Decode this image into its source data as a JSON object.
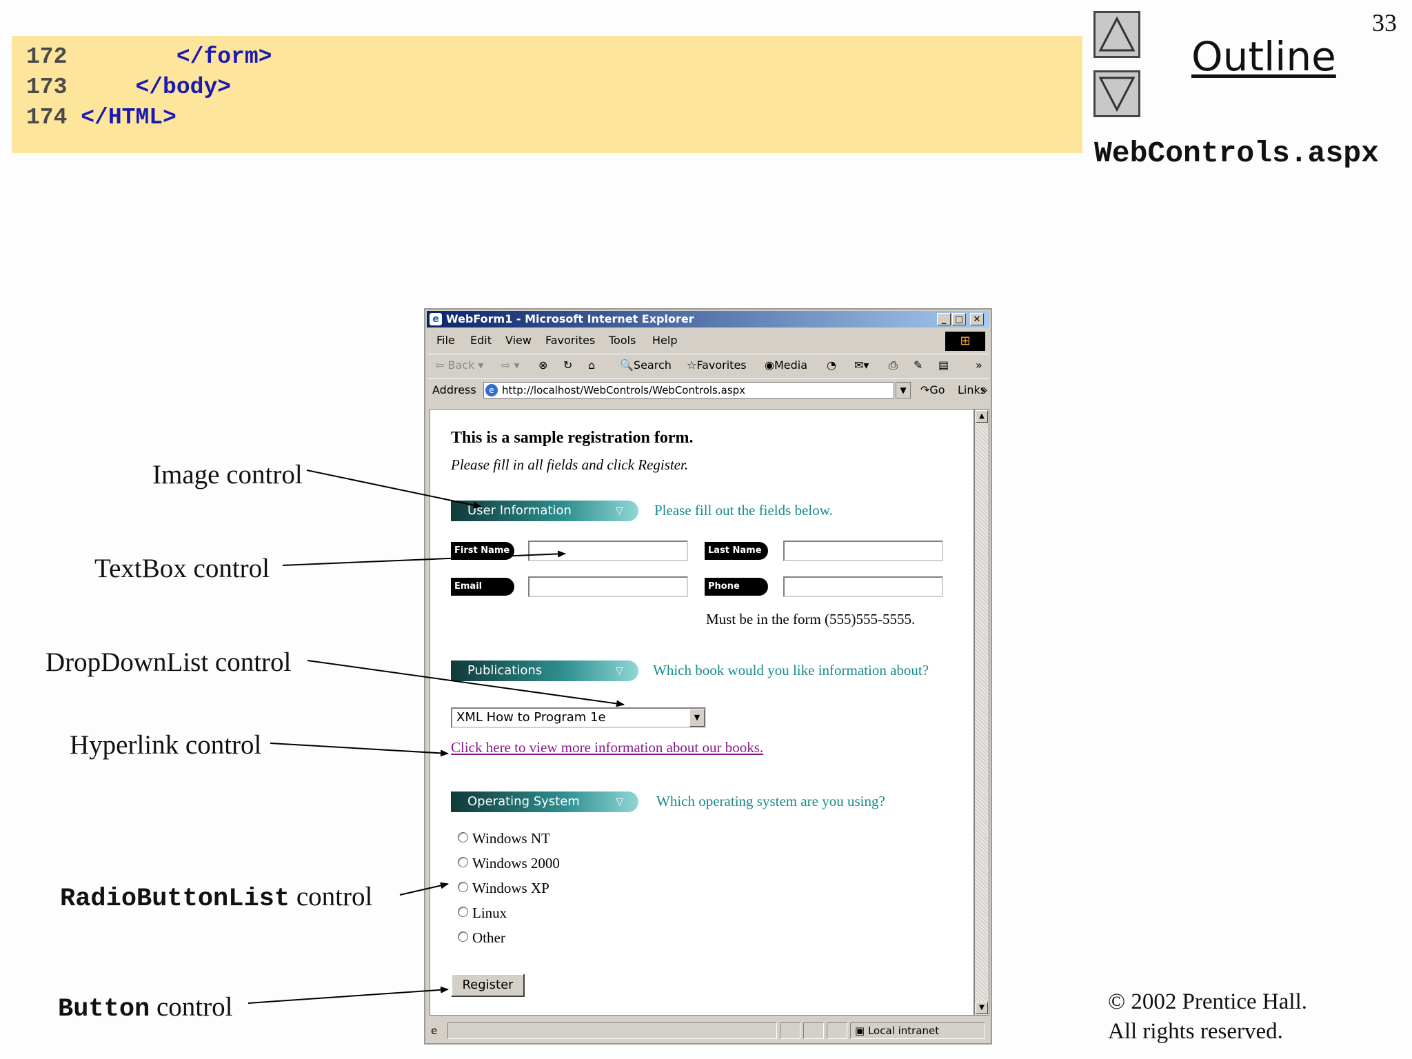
{
  "slide": {
    "page_number": "33",
    "outline_link": "Outline",
    "file_title": "WebControls.aspx",
    "copyright_line1": "© 2002 Prentice Hall.",
    "copyright_line2": "All rights reserved."
  },
  "code": {
    "lines": [
      {
        "num": "172",
        "text": "      </form>"
      },
      {
        "num": "173",
        "text": "   </body>"
      },
      {
        "num": "174",
        "text": "</HTML>"
      }
    ]
  },
  "callouts": {
    "image": "Image control",
    "textbox": "TextBox control",
    "dropdown": "DropDownList control",
    "hyperlink": "Hyperlink control",
    "radio_mono": "RadioButtonList",
    "radio_rest": " control",
    "button_mono": "Button",
    "button_rest": " control"
  },
  "browser": {
    "title": "WebForm1 - Microsoft Internet Explorer",
    "menu": [
      "File",
      "Edit",
      "View",
      "Favorites",
      "Tools",
      "Help"
    ],
    "toolbar": {
      "back": "Back",
      "search": "Search",
      "favorites": "Favorites",
      "media": "Media"
    },
    "address_label": "Address",
    "address_url": "http://localhost/WebControls/WebControls.aspx",
    "go": "Go",
    "links": "Links",
    "status_zone": "Local intranet"
  },
  "form": {
    "heading": "This is a sample registration form.",
    "subheading": "Please fill in all fields and click Register.",
    "sections": {
      "user_info": {
        "label": "User Information",
        "prompt": "Please fill out the fields below."
      },
      "publications": {
        "label": "Publications",
        "prompt": "Which book would you like information about?"
      },
      "os": {
        "label": "Operating System",
        "prompt": "Which operating system are you using?"
      }
    },
    "fields": {
      "first_name": "First Name",
      "last_name": "Last Name",
      "email": "Email",
      "phone": "Phone"
    },
    "phone_note": "Must be in the form (555)555-5555.",
    "book_selected": "XML How to Program 1e",
    "link_text": "Click here to view more information about our books.",
    "os_options": [
      "Windows NT",
      "Windows 2000",
      "Windows XP",
      "Linux",
      "Other"
    ],
    "register": "Register"
  }
}
